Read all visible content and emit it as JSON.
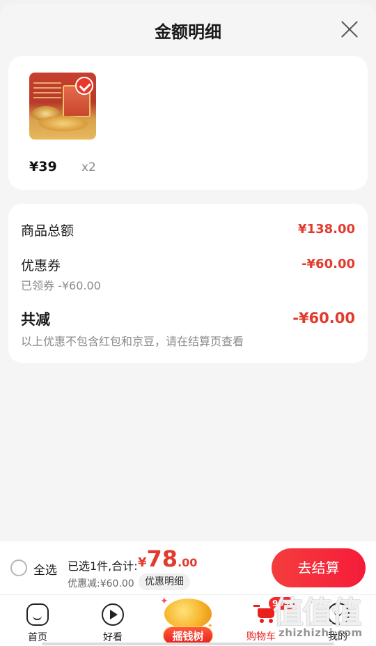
{
  "header": {
    "title": "金额明细"
  },
  "product": {
    "price": "¥39",
    "quantity": "x2"
  },
  "details": {
    "goods_total_label": "商品总额",
    "goods_total_value": "¥138.00",
    "coupon_label": "优惠券",
    "coupon_value": "-¥60.00",
    "coupon_sub": "已领券 -¥60.00",
    "total_reduce_label": "共减",
    "total_reduce_value": "-¥60.00",
    "note": "以上优惠不包含红包和京豆，请在结算页查看"
  },
  "bottom_bar": {
    "select_all": "全选",
    "selected_text": "已选1件,合计:",
    "total_symbol": "¥",
    "total_int": "78",
    "total_dec": ".00",
    "discount_text": "优惠减:¥60.00",
    "detail_chip": "优惠明细",
    "checkout_label": "去结算"
  },
  "tabbar": {
    "home": "首页",
    "watch": "好看",
    "tree": "摇钱树",
    "cart": "购物车",
    "cart_badge": "99+",
    "mine": "我的"
  },
  "watermark": {
    "glyphs": "值值值",
    "text": "zhizhizhi.com"
  },
  "colors": {
    "accent": "#e23b2e",
    "checkout": "#f51c3a",
    "background": "#f5f5f5"
  }
}
